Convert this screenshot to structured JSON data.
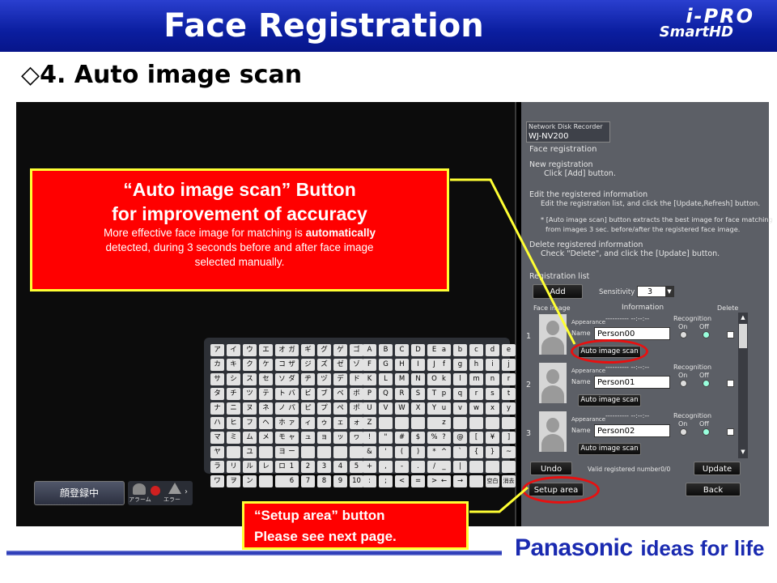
{
  "header": {
    "title": "Face Registration",
    "brand_logo_line1": "i-PRO",
    "brand_logo_line2": "SmartHD"
  },
  "subtitle": "◇4. Auto image scan",
  "left_view": {
    "status_button": "顔登録中",
    "alarm_label": "アラーム",
    "error_label": "エラー",
    "keyboard": {
      "kana1": [
        "ア",
        "イ",
        "ウ",
        "エ",
        "オ",
        "カ",
        "キ",
        "ク",
        "ケ",
        "コ",
        "サ",
        "シ",
        "ス",
        "セ",
        "ソ",
        "タ",
        "チ",
        "ツ",
        "テ",
        "ト",
        "ナ",
        "ニ",
        "ヌ",
        "ネ",
        "ノ",
        "ハ",
        "ヒ",
        "フ",
        "ヘ",
        "ホ",
        "マ",
        "ミ",
        "ム",
        "メ",
        "モ",
        "ヤ",
        "",
        "ユ",
        "",
        "ヨ",
        "ラ",
        "リ",
        "ル",
        "レ",
        "ロ",
        "ワ",
        "ヲ",
        "ン",
        "",
        ""
      ],
      "kana2": [
        "ガ",
        "ギ",
        "グ",
        "ゲ",
        "ゴ",
        "ザ",
        "ジ",
        "ズ",
        "ゼ",
        "ゾ",
        "ダ",
        "ヂ",
        "ヅ",
        "デ",
        "ド",
        "バ",
        "ビ",
        "ブ",
        "ベ",
        "ボ",
        "パ",
        "ピ",
        "プ",
        "ペ",
        "ポ",
        "ァ",
        "ィ",
        "ゥ",
        "ェ",
        "ォ",
        "ャ",
        "ュ",
        "ョ",
        "ッ",
        "ヮ",
        "ー",
        "",
        "",
        "",
        "",
        "1",
        "2",
        "3",
        "4",
        "5",
        "6",
        "7",
        "8",
        "9",
        "10"
      ],
      "upper": [
        "A",
        "B",
        "C",
        "D",
        "E",
        "F",
        "G",
        "H",
        "I",
        "J",
        "K",
        "L",
        "M",
        "N",
        "O",
        "P",
        "Q",
        "R",
        "S",
        "T",
        "U",
        "V",
        "W",
        "X",
        "Y",
        "Z",
        "",
        "",
        "",
        "",
        "!",
        "\"",
        "#",
        "$",
        "%",
        "&",
        "'",
        "(",
        ")",
        "*",
        "+",
        ",",
        "-",
        ".",
        "/",
        ":",
        ";",
        "<",
        "=",
        ">"
      ],
      "lower": [
        "a",
        "b",
        "c",
        "d",
        "e",
        "f",
        "g",
        "h",
        "i",
        "j",
        "k",
        "l",
        "m",
        "n",
        "r",
        "p",
        "q",
        "r",
        "s",
        "t",
        "u",
        "v",
        "w",
        "x",
        "y",
        "z",
        "",
        "",
        "",
        "",
        "?",
        "@",
        "[",
        "¥",
        "]",
        "^",
        "`",
        "{",
        "}",
        "~",
        "_",
        "|",
        "",
        "",
        "",
        "←",
        "→",
        "",
        "空白",
        "消去"
      ]
    }
  },
  "panel": {
    "product_line": "Network Disk Recorder",
    "model": "WJ-NV200",
    "heading": "Face registration",
    "new_registration_title": "New registration",
    "new_registration_text": "Click [Add] button.",
    "edit_title": "Edit the registered information",
    "edit_text": "Edit the registration list, and click the [Update,Refresh] button.",
    "note_line1": "* [Auto image scan] button extracts the best image for face matching",
    "note_line2": "from images 3 sec. before/after the registered face image.",
    "delete_title": "Delete registered information",
    "delete_text": "Check \"Delete\", and click the [Update] button.",
    "registration_list_label": "Registration list",
    "add_button": "Add",
    "sensitivity_label": "Sensitivity",
    "sensitivity_value": "3",
    "col_face_image": "Face image",
    "col_information": "Information",
    "col_delete": "Delete",
    "entries": [
      {
        "index": "1",
        "appearance_label": "Appearance",
        "appearance_value": "---------- --:--:--",
        "name_label": "Name",
        "name_value": "Person00",
        "recognition_label": "Recognition",
        "on_label": "On",
        "off_label": "Off",
        "scan_button": "Auto image scan"
      },
      {
        "index": "2",
        "appearance_label": "Appearance",
        "appearance_value": "---------- --:--:--",
        "name_label": "Name",
        "name_value": "Person01",
        "recognition_label": "Recognition",
        "on_label": "On",
        "off_label": "Off",
        "scan_button": "Auto image scan"
      },
      {
        "index": "3",
        "appearance_label": "Appearance",
        "appearance_value": "---------- --:--:--",
        "name_label": "Name",
        "name_value": "Person02",
        "recognition_label": "Recognition",
        "on_label": "On",
        "off_label": "Off",
        "scan_button": "Auto image scan"
      }
    ],
    "undo_button": "Undo",
    "valid_count": "Valid registered number0/0",
    "update_button": "Update",
    "setup_button": "Setup area",
    "back_button": "Back"
  },
  "callout_main": {
    "title_line1": "“Auto image scan” Button",
    "title_line2": "for improvement of accuracy",
    "body_line1_a": "More effective face image for matching is ",
    "body_line1_b": "automatically",
    "body_line2": "detected, during 3 seconds before and after face image",
    "body_line3": "selected manually."
  },
  "callout_setup": {
    "line1": "“Setup area” button",
    "line2": "Please see next page."
  },
  "footer": {
    "brand": "Panasonic",
    "tagline": "ideas for life"
  },
  "colors": {
    "header_blue": "#0b1ea0",
    "callout_red": "#ff0000",
    "callout_border": "#ffff33",
    "brand_blue": "#1a2ab0"
  }
}
